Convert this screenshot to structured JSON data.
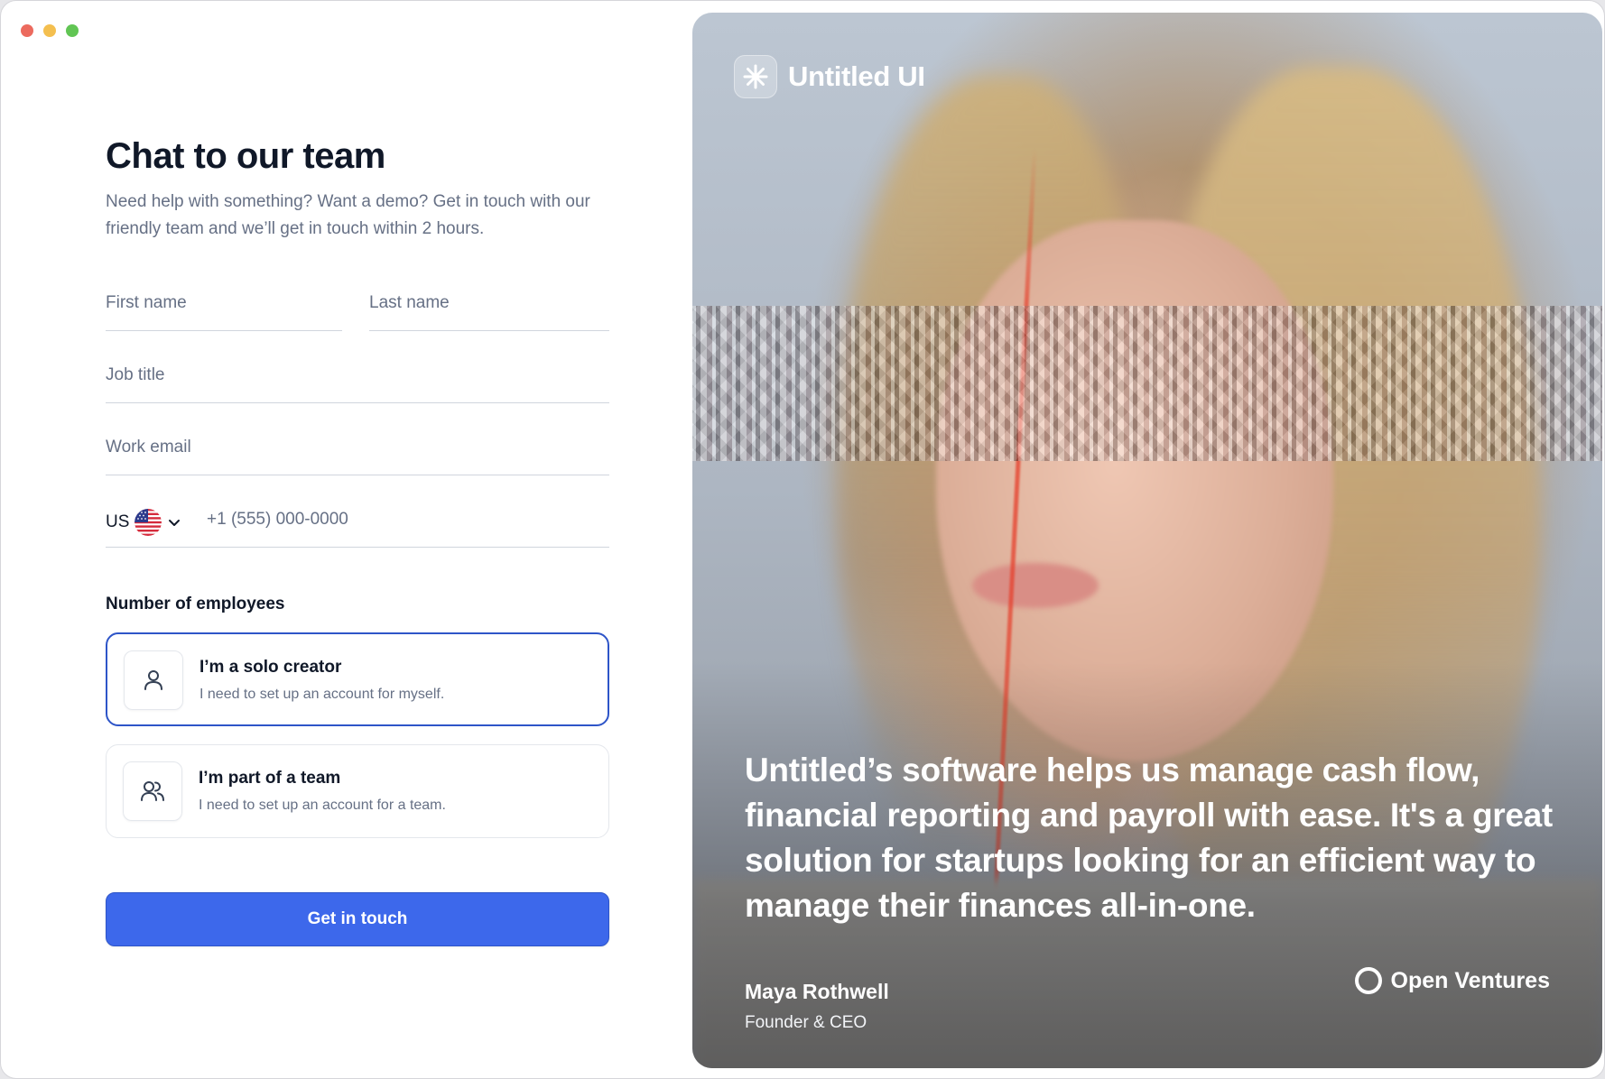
{
  "form": {
    "title": "Chat to our team",
    "subtitle": "Need help with something? Want a demo? Get in touch with our friendly team and we’ll get in touch within 2 hours.",
    "first_name_placeholder": "First name",
    "last_name_placeholder": "Last name",
    "job_title_placeholder": "Job title",
    "work_email_placeholder": "Work email",
    "phone": {
      "country_code": "US",
      "placeholder": "+1 (555) 000-0000"
    },
    "employees_label": "Number of employees",
    "options": [
      {
        "title": "I’m a solo creator",
        "description": "I need to set up an account for myself.",
        "selected": true,
        "icon": "user-icon"
      },
      {
        "title": "I’m part of a team",
        "description": "I need to set up an account for a team.",
        "selected": false,
        "icon": "users-icon"
      }
    ],
    "submit_label": "Get in touch"
  },
  "panel": {
    "brand": "Untitled UI",
    "quote": "Untitled’s software helps us manage cash flow, financial reporting and payroll with ease. It's a great solution for startups looking for an efficient way to manage their finances all-in-one.",
    "author_name": "Maya Rothwell",
    "author_role": "Founder & CEO",
    "company": "Open Ventures"
  },
  "colors": {
    "accent": "#3d68eb",
    "selected_border": "#2e55c8",
    "muted_text": "#667085"
  }
}
